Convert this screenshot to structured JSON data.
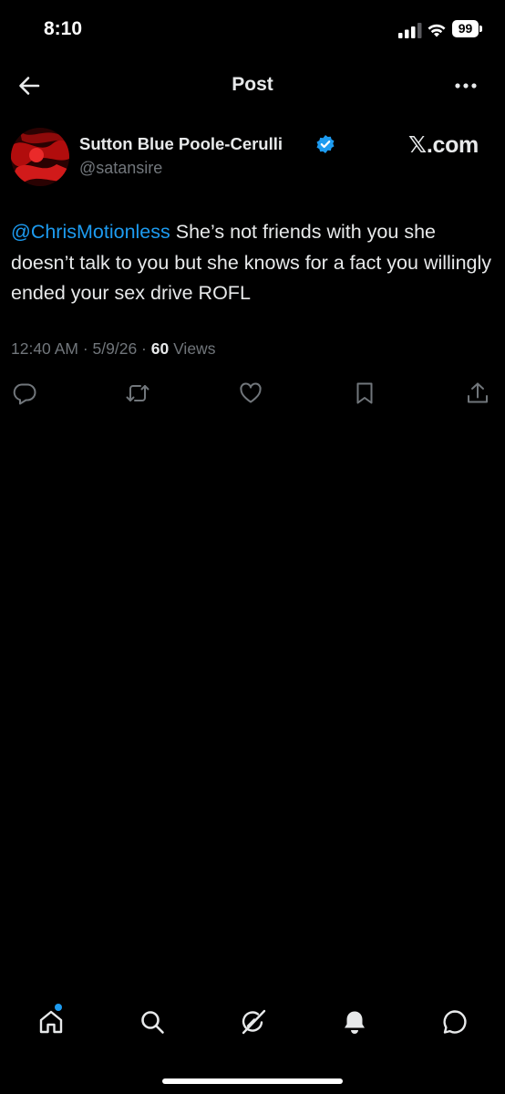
{
  "status_bar": {
    "time": "8:10",
    "battery": "99"
  },
  "header": {
    "title": "Post"
  },
  "author": {
    "name": "Sutton Blue Poole-Cerulli",
    "handle": "@satansire",
    "verified": true
  },
  "brand": {
    "label": "𝕏.com"
  },
  "post": {
    "mention": "@ChrisMotionless",
    "text": " She’s not friends with you she doesn’t talk to you but she knows for a fact you willingly ended your sex drive ROFL",
    "time": "12:40 AM",
    "date": "5/9/26",
    "views_count": "60",
    "views_label": "Views"
  },
  "actions": [
    "reply-icon",
    "repost-icon",
    "like-icon",
    "bookmark-icon",
    "share-icon"
  ],
  "bottom_nav": [
    "home-icon",
    "search-icon",
    "grok-icon",
    "notifications-icon",
    "messages-icon"
  ],
  "colors": {
    "background": "#000000",
    "accent": "#1d9bf0",
    "secondary_text": "#71767b",
    "primary_text": "#e7e9ea"
  }
}
